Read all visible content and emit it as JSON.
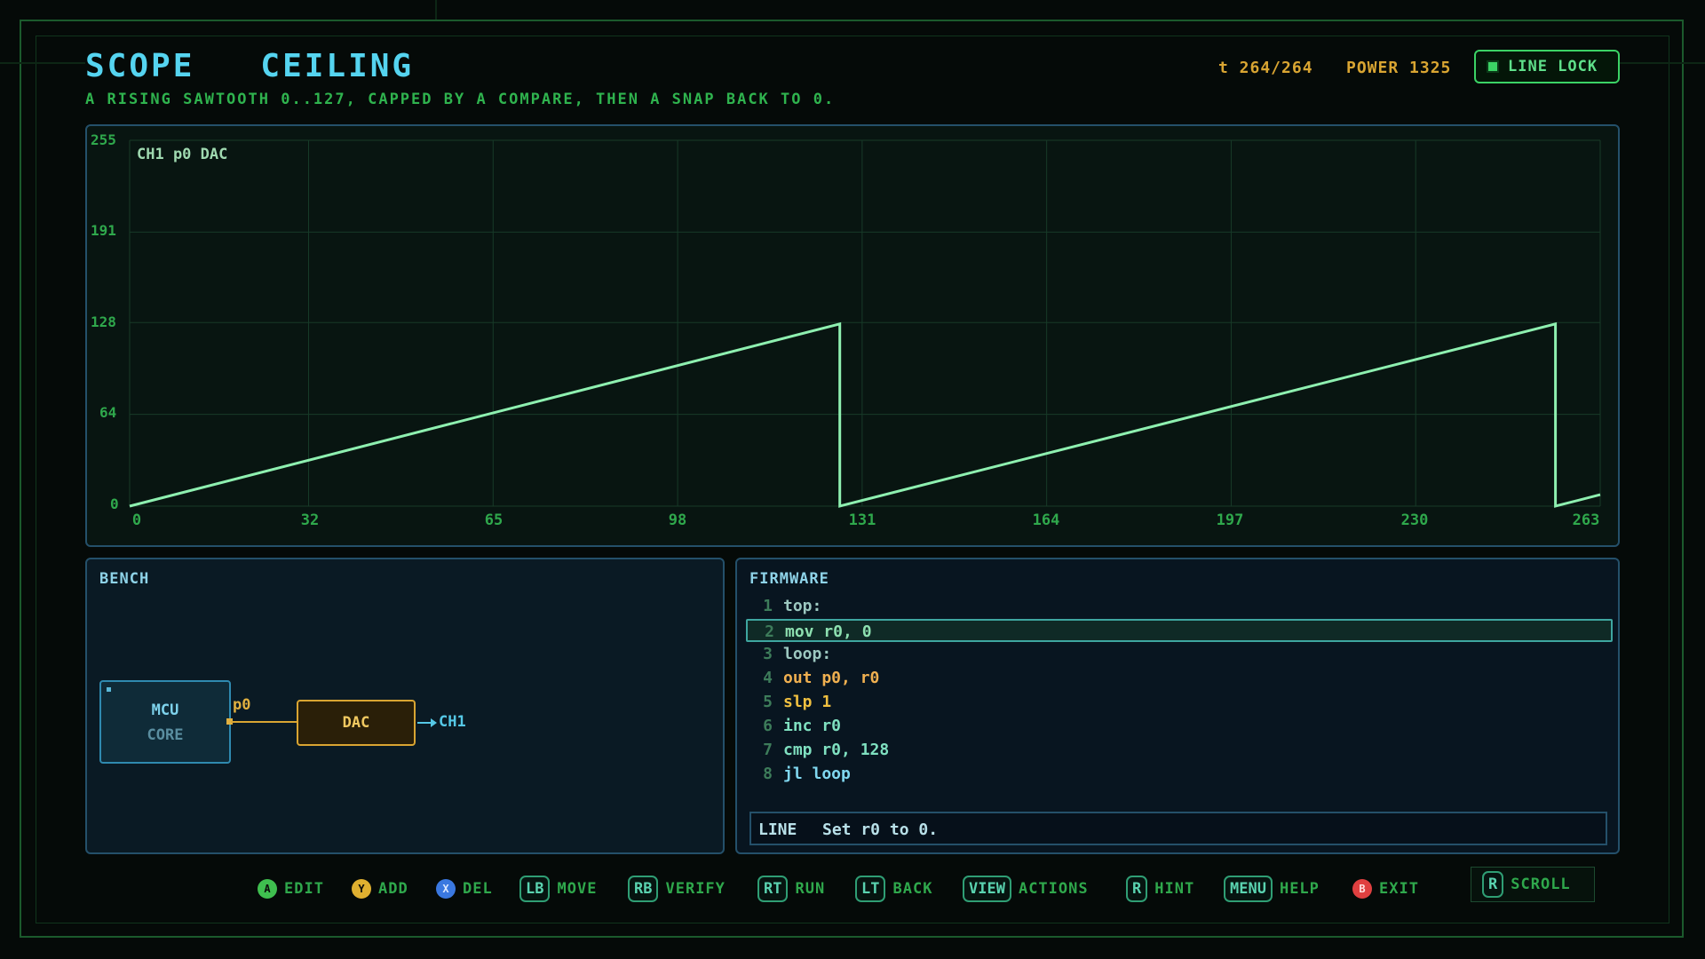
{
  "header": {
    "title": "SCOPE   CEILING",
    "subtitle": "A RISING SAWTOOTH 0..127, CAPPED BY A COMPARE, THEN A SNAP BACK TO 0.",
    "time": "t 264/264",
    "power": "POWER 1325",
    "line_lock": "LINE LOCK"
  },
  "scope": {
    "channel_label": "CH1 p0 DAC",
    "y_ticks": [
      "255",
      "191",
      "128",
      "64",
      "0"
    ],
    "x_ticks": [
      "0",
      "32",
      "65",
      "98",
      "131",
      "164",
      "197",
      "230",
      "263"
    ]
  },
  "chart_data": {
    "type": "line",
    "title": "CH1 p0 DAC",
    "xlabel": "",
    "ylabel": "",
    "xlim": [
      0,
      263
    ],
    "ylim": [
      0,
      255
    ],
    "x_ticks": [
      0,
      32,
      65,
      98,
      131,
      164,
      197,
      230,
      263
    ],
    "y_ticks": [
      0,
      64,
      128,
      191,
      255
    ],
    "grid": true,
    "series": [
      {
        "color": "#8ef0b0",
        "points": [
          [
            0,
            0
          ],
          [
            127,
            127
          ],
          [
            127,
            0
          ],
          [
            255,
            127
          ],
          [
            255,
            0
          ],
          [
            263,
            8
          ]
        ]
      }
    ]
  },
  "bench": {
    "title": "BENCH",
    "mcu_line1": "MCU",
    "mcu_line2": "CORE",
    "pin_label": "p0",
    "dac_label": "DAC",
    "output_label": "CH1"
  },
  "firmware": {
    "title": "FIRMWARE",
    "lines": [
      {
        "num": "1",
        "text": "top:"
      },
      {
        "num": "2",
        "text": "mov r0, 0"
      },
      {
        "num": "3",
        "text": "loop:"
      },
      {
        "num": "4",
        "text": "out p0, r0"
      },
      {
        "num": "5",
        "text": "slp 1"
      },
      {
        "num": "6",
        "text": "inc r0"
      },
      {
        "num": "7",
        "text": "cmp r0, 128"
      },
      {
        "num": "8",
        "text": "jl loop"
      }
    ],
    "info_tag": "LINE",
    "info_text": "Set r0 to 0."
  },
  "footer": {
    "buttons": [
      {
        "key": "A",
        "label": "EDIT",
        "color": "#3fbf4f"
      },
      {
        "key": "Y",
        "label": "ADD",
        "color": "#e0b030"
      },
      {
        "key": "X",
        "label": "DEL",
        "color": "#3a78e0"
      },
      {
        "key": "LB",
        "label": "MOVE"
      },
      {
        "key": "RB",
        "label": "VERIFY"
      },
      {
        "key": "RT",
        "label": "RUN"
      },
      {
        "key": "LT",
        "label": "BACK"
      },
      {
        "key": "VIEW",
        "label": "ACTIONS"
      },
      {
        "key": "R",
        "label": "HINT"
      },
      {
        "key": "MENU",
        "label": "HELP"
      },
      {
        "key": "B",
        "label": "EXIT",
        "color": "#e04040"
      }
    ],
    "scroll_key": "R",
    "scroll_label": "SCROLL"
  }
}
